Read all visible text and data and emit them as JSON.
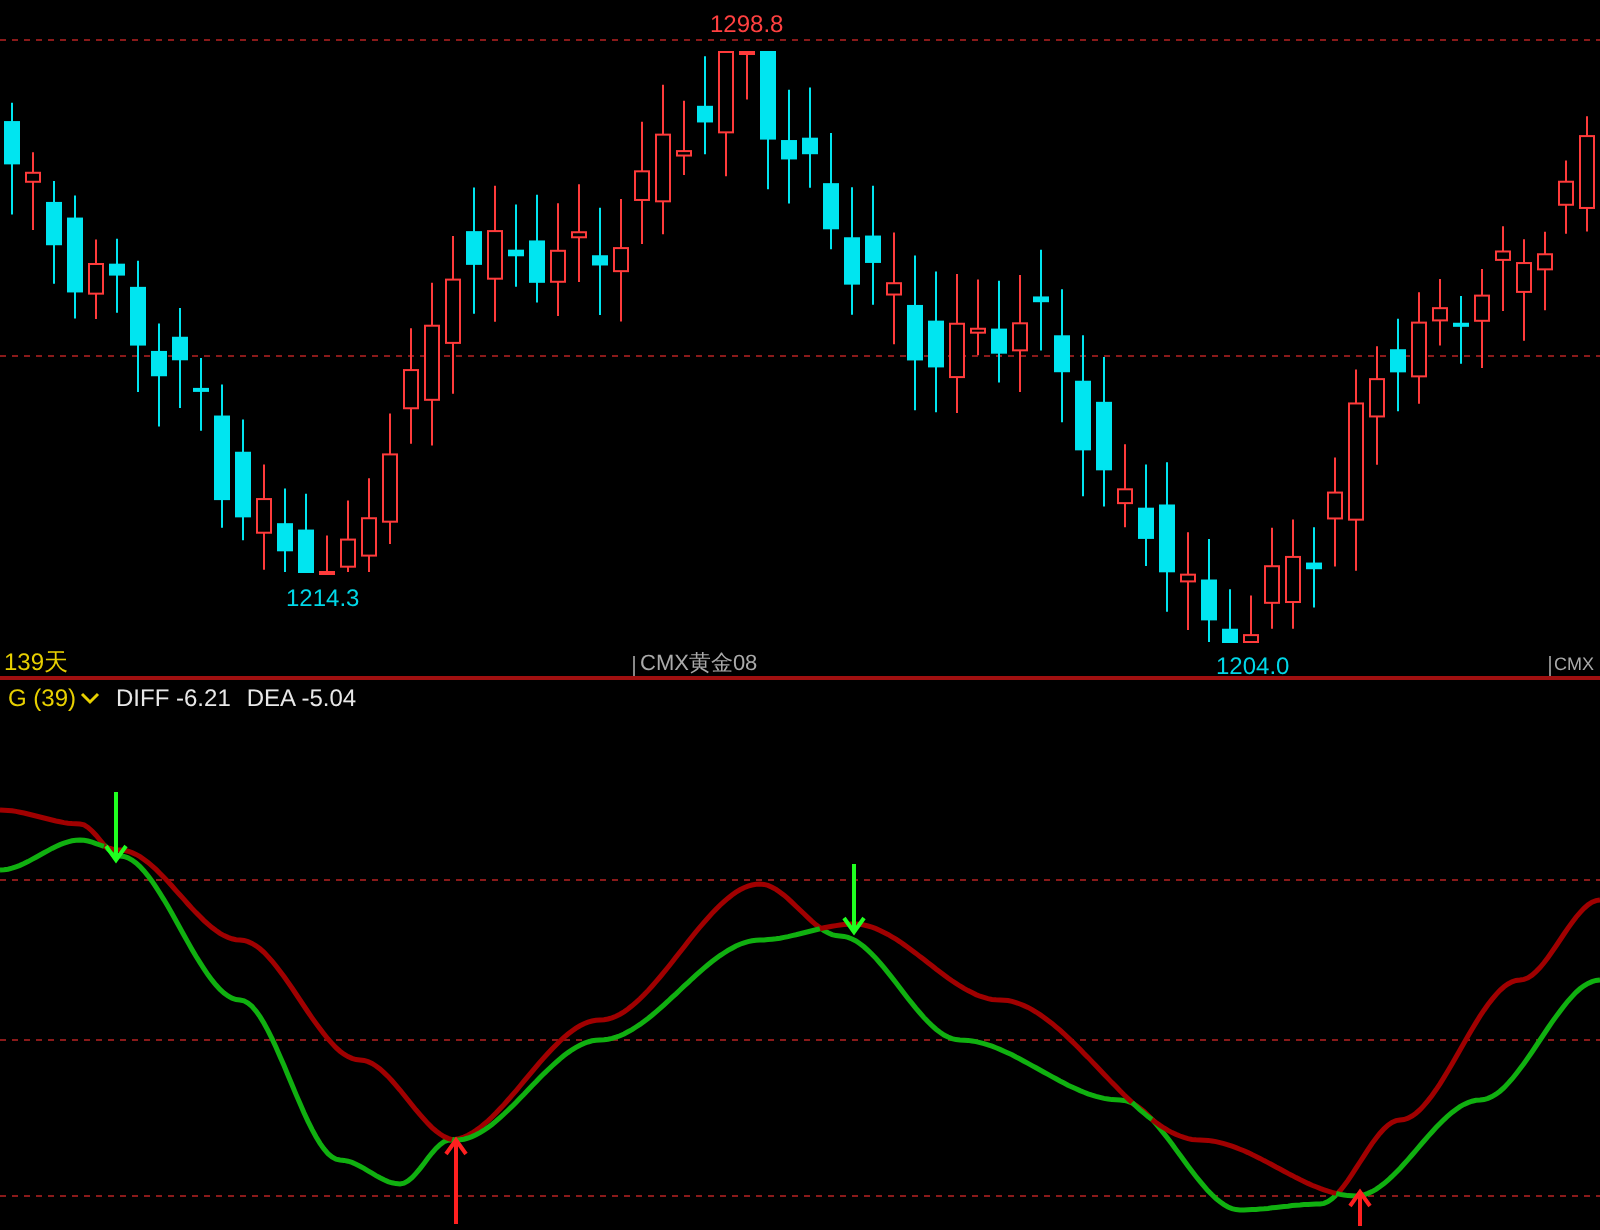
{
  "main_chart": {
    "high_label": "1298.8",
    "low_labels": [
      "1214.3",
      "1204.0"
    ],
    "period": "139天",
    "symbol_labels": [
      "CMX黄金08",
      "CMX"
    ]
  },
  "indicator": {
    "name": "G (39)",
    "diff": "DIFF -6.21",
    "dea": "DEA -5.04"
  }
}
